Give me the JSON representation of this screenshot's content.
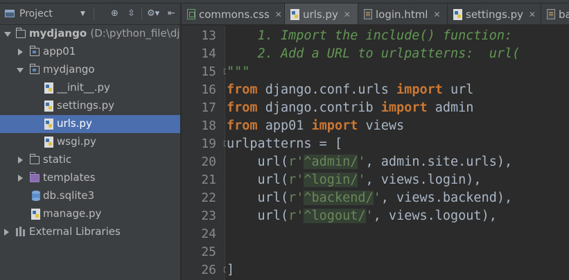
{
  "project_panel": {
    "title": "Project",
    "tree": [
      {
        "label": "mydjango",
        "hint": "(D:\\python_file\\dj",
        "bold": true,
        "depth": 0,
        "expanded": true,
        "icon": "folder-icon"
      },
      {
        "label": "app01",
        "depth": 1,
        "expanded": false,
        "icon": "module-folder-icon"
      },
      {
        "label": "mydjango",
        "depth": 1,
        "expanded": true,
        "icon": "module-folder-icon"
      },
      {
        "label": "__init__.py",
        "depth": 2,
        "icon": "python-file-icon"
      },
      {
        "label": "settings.py",
        "depth": 2,
        "icon": "python-file-icon"
      },
      {
        "label": "urls.py",
        "depth": 2,
        "icon": "python-file-icon",
        "selected": true
      },
      {
        "label": "wsgi.py",
        "depth": 2,
        "icon": "python-file-icon"
      },
      {
        "label": "static",
        "depth": 1,
        "expanded": false,
        "icon": "folder-icon"
      },
      {
        "label": "templates",
        "depth": 1,
        "expanded": false,
        "icon": "templates-folder-icon"
      },
      {
        "label": "db.sqlite3",
        "depth": 1,
        "icon": "database-icon"
      },
      {
        "label": "manage.py",
        "depth": 1,
        "icon": "python-file-icon"
      },
      {
        "label": "External Libraries",
        "depth": 0,
        "expanded": false,
        "icon": "libraries-icon"
      }
    ]
  },
  "tabs": [
    {
      "label": "commons.css",
      "icon": "css-file-icon",
      "active": false
    },
    {
      "label": "urls.py",
      "icon": "python-file-icon",
      "active": true
    },
    {
      "label": "login.html",
      "icon": "html-file-icon",
      "active": false
    },
    {
      "label": "settings.py",
      "icon": "python-file-icon",
      "active": false
    },
    {
      "label": "ba",
      "icon": "html-file-icon",
      "active": false
    }
  ],
  "editor": {
    "line_numbers": [
      "13",
      "14",
      "15",
      "16",
      "17",
      "18",
      "19",
      "20",
      "21",
      "22",
      "23",
      "24",
      "25",
      "26"
    ],
    "lines": [
      {
        "n": "13",
        "text": "    1. Import the include() function: "
      },
      {
        "n": "14",
        "text": "    2. Add a URL to urlpatterns:  url("
      },
      {
        "n": "15",
        "text": "\"\"\""
      },
      {
        "n": "16",
        "kw1": "from",
        "mod": " django.conf.urls ",
        "kw2": "import",
        "name": " url"
      },
      {
        "n": "17",
        "kw1": "from",
        "mod": " django.contrib ",
        "kw2": "import",
        "name": " admin"
      },
      {
        "n": "18",
        "kw1": "from",
        "mod": " app01 ",
        "kw2": "import",
        "name": " views"
      },
      {
        "n": "19",
        "text": "urlpatterns = ["
      },
      {
        "n": "20",
        "pre": "    url(",
        "s1": "r'",
        "s2": "^admin/",
        "s3": "'",
        "post": ", admin.site.urls),"
      },
      {
        "n": "21",
        "pre": "    url(",
        "s1": "r'",
        "s2": "^login/",
        "s3": "'",
        "post": ", views.login),"
      },
      {
        "n": "22",
        "pre": "    url(",
        "s1": "r'",
        "s2": "^backend/",
        "s3": "'",
        "post": ", views.backend),"
      },
      {
        "n": "23",
        "pre": "    url(",
        "s1": "r'",
        "s2": "^logout/",
        "s3": "'",
        "post": ", views.logout),"
      },
      {
        "n": "24",
        "text": ""
      },
      {
        "n": "25",
        "text": ""
      },
      {
        "n": "26",
        "text": "]"
      }
    ]
  },
  "colors": {
    "keyword": "#cc7832",
    "string": "#6a8759",
    "comment": "#629755",
    "text": "#a9b7c6",
    "selection": "#4b6eaf"
  }
}
